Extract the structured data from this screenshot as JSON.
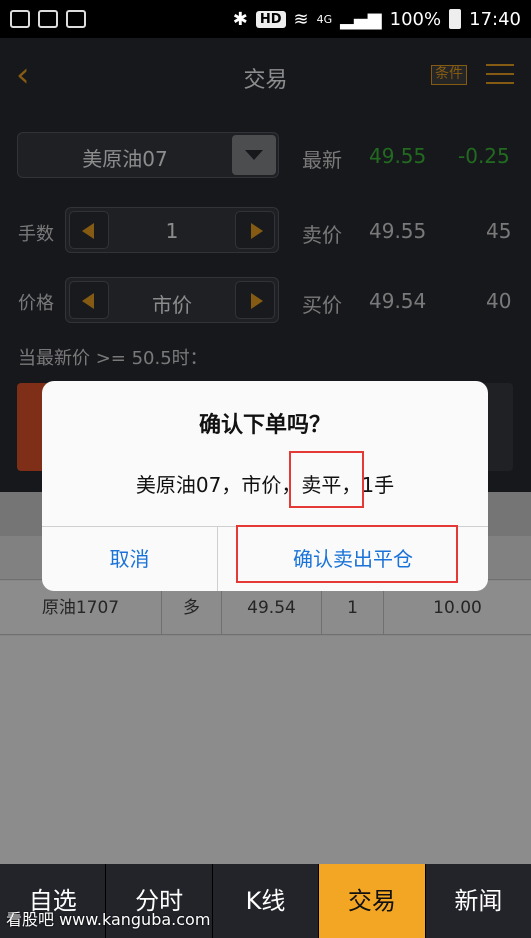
{
  "status_bar": {
    "hd": "HD",
    "network": "4G",
    "battery": "100%",
    "time": "17:40"
  },
  "nav": {
    "back_icon": "chevron-left-icon",
    "title": "交易",
    "condition_button": "条件",
    "menu_icon": "hamburger-menu-icon"
  },
  "trade_panel": {
    "contract": "美原油07",
    "quantity_label": "手数",
    "quantity_value": "1",
    "price_label": "价格",
    "price_value": "市价",
    "condition_text": "当最新价 >= 50.5时："
  },
  "quotes": {
    "latest_label": "最新",
    "latest_price": "49.55",
    "latest_change": "-0.25",
    "sell_label": "卖价",
    "sell_price": "49.55",
    "sell_volume": "45",
    "buy_label": "买价",
    "buy_price": "49.54",
    "buy_volume": "40"
  },
  "positions": {
    "rows": [
      {
        "contract": "原油1707",
        "direction": "多",
        "price": "49.54",
        "quantity": "1",
        "value": "10.00"
      }
    ]
  },
  "dialog": {
    "title": "确认下单吗？",
    "message": "美原油07，市价，卖平，1手",
    "cancel": "取消",
    "confirm": "确认卖出平仓"
  },
  "tabs": [
    "自选",
    "分时",
    "K线",
    "交易",
    "新闻"
  ],
  "active_tab": "交易",
  "watermark": "看股吧 www.kanguba.com",
  "colors": {
    "accent": "#f3a623",
    "up_green": "#3dc23a",
    "sell_red": "#e8552a",
    "dialog_blue": "#1a73d9",
    "highlight_red": "#e53935"
  }
}
